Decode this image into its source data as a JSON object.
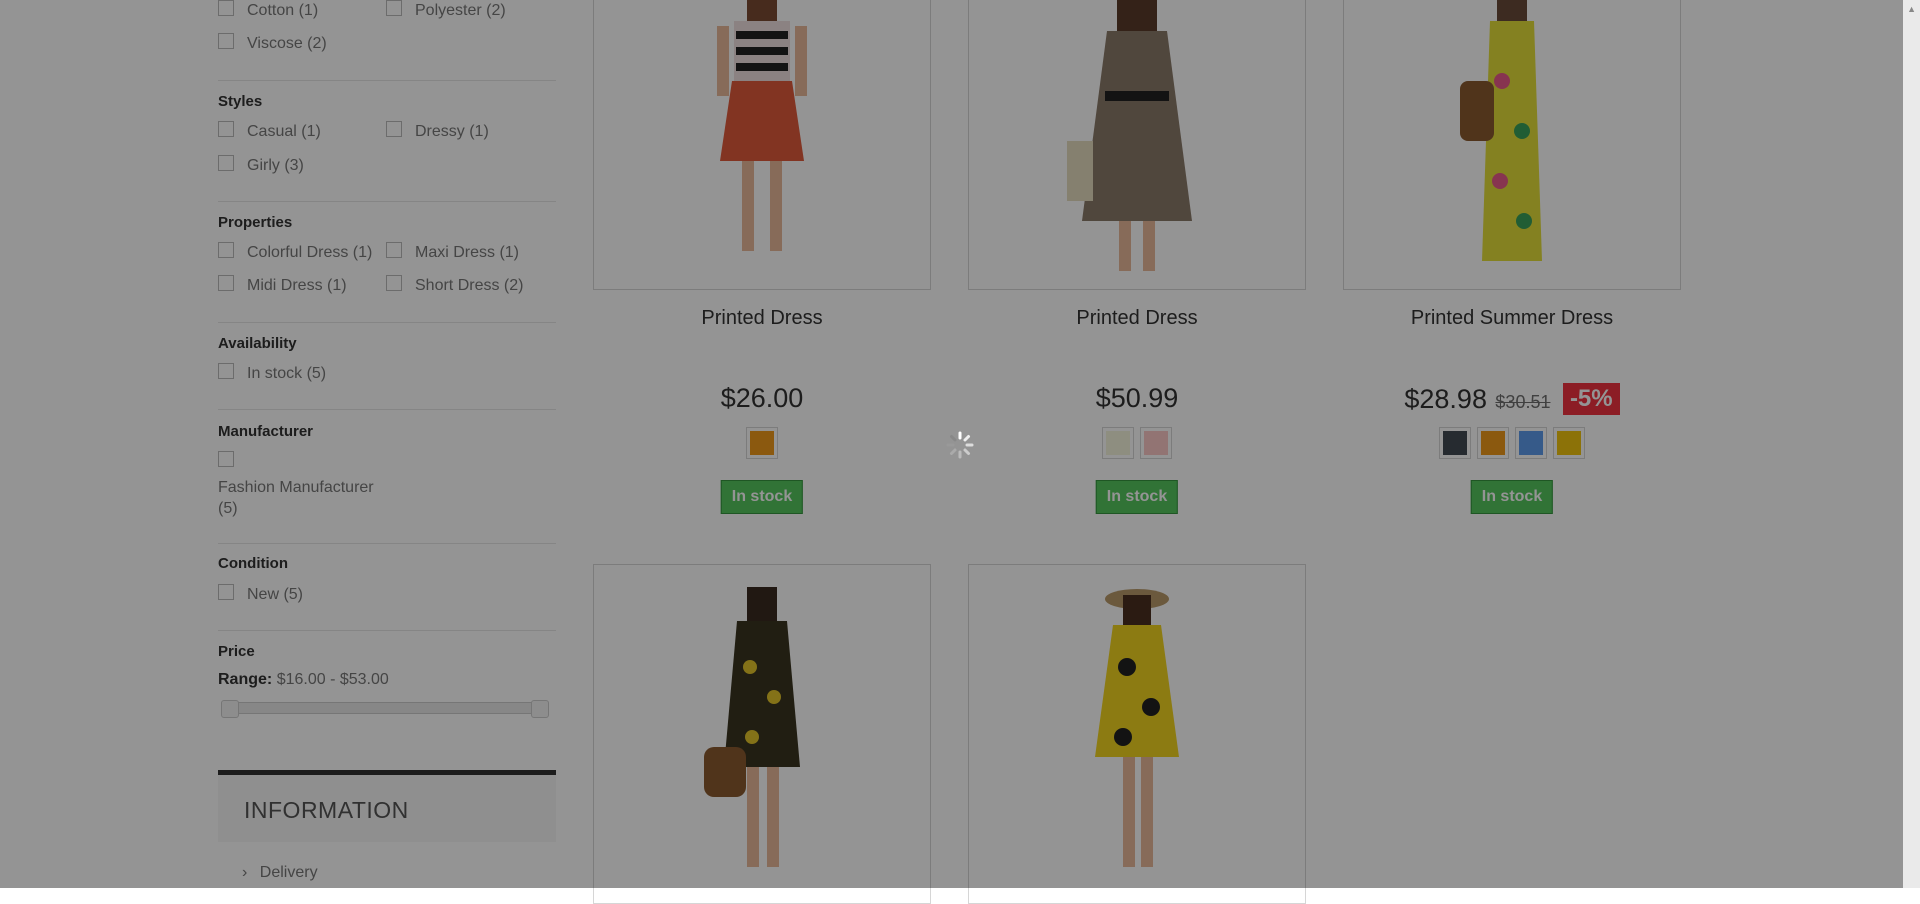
{
  "filters": {
    "compositions": {
      "options": [
        {
          "label": "Cotton (1)"
        },
        {
          "label": "Polyester (2)"
        },
        {
          "label": "Viscose (2)"
        }
      ]
    },
    "styles": {
      "title": "Styles",
      "options": [
        {
          "label": "Casual (1)"
        },
        {
          "label": "Dressy (1)"
        },
        {
          "label": "Girly (3)"
        }
      ]
    },
    "properties": {
      "title": "Properties",
      "options": [
        {
          "label": "Colorful Dress (1)"
        },
        {
          "label": "Maxi Dress (1)"
        },
        {
          "label": "Midi Dress (1)"
        },
        {
          "label": "Short Dress (2)"
        }
      ]
    },
    "availability": {
      "title": "Availability",
      "options": [
        {
          "label": "In stock (5)"
        }
      ]
    },
    "manufacturer": {
      "title": "Manufacturer",
      "options": [
        {
          "label_line1": "Fashion Manufacturer",
          "label_line2": "(5)"
        }
      ]
    },
    "condition": {
      "title": "Condition",
      "options": [
        {
          "label": "New (5)"
        }
      ]
    },
    "price": {
      "title": "Price",
      "range_label": "Range:",
      "range_value": "$16.00 - $53.00",
      "min": 16.0,
      "max": 53.0
    }
  },
  "information": {
    "title": "INFORMATION",
    "links": [
      {
        "label": "Delivery"
      }
    ]
  },
  "products": [
    {
      "name": "Printed Dress",
      "price": "$26.00",
      "colors": [
        "#f09a1a"
      ],
      "availability": "In stock"
    },
    {
      "name": "Printed Dress",
      "price": "$50.99",
      "colors": [
        "#f5f5dc",
        "#fcc8c6"
      ],
      "availability": "In stock"
    },
    {
      "name": "Printed Summer Dress",
      "price": "$28.98",
      "old_price": "$30.51",
      "discount": "-5%",
      "colors": [
        "#434a54",
        "#f09a1a",
        "#5d9cec",
        "#f1c40f"
      ],
      "availability": "In stock"
    },
    {
      "name": "",
      "price": "",
      "colors": [],
      "availability": ""
    },
    {
      "name": "",
      "price": "",
      "colors": [],
      "availability": ""
    }
  ],
  "icons": {
    "loading": "loading-spinner-icon",
    "delivery_chevron": "chevron-right-icon",
    "scroll_up": "scroll-up-arrow-icon"
  },
  "colors": {
    "in_stock_bg": "#55c65e",
    "discount_bg": "#f13340",
    "overlay": "rgba(0,0,0,0.42)"
  }
}
